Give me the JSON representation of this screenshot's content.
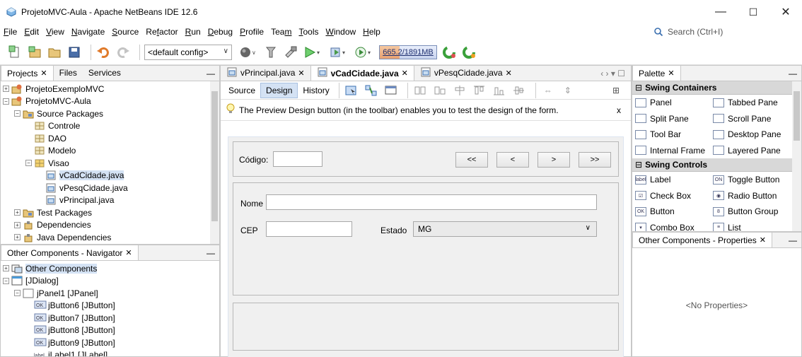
{
  "window": {
    "title": "ProjetoMVC-Aula - Apache NetBeans IDE 12.6",
    "minimize": "—",
    "maximize": "☐",
    "close": "✕"
  },
  "menu": {
    "items": [
      "File",
      "Edit",
      "View",
      "Navigate",
      "Source",
      "Refactor",
      "Run",
      "Debug",
      "Profile",
      "Team",
      "Tools",
      "Window",
      "Help"
    ],
    "search_placeholder": "Search (Ctrl+I)"
  },
  "toolbar": {
    "config": "<default config>",
    "memory": "665.2/1891MB",
    "memory_fraction": 0.35
  },
  "projects_panel": {
    "tabs": [
      "Projects",
      "Files",
      "Services"
    ],
    "tree": [
      {
        "label": "ProjetoExemploMVC",
        "level": 0,
        "exp": "+",
        "icon": "project"
      },
      {
        "label": "ProjetoMVC-Aula",
        "level": 0,
        "exp": "-",
        "icon": "project"
      },
      {
        "label": "Source Packages",
        "level": 1,
        "exp": "-",
        "icon": "folder"
      },
      {
        "label": "Controle",
        "level": 2,
        "exp": "",
        "icon": "package"
      },
      {
        "label": "DAO",
        "level": 2,
        "exp": "",
        "icon": "package"
      },
      {
        "label": "Modelo",
        "level": 2,
        "exp": "",
        "icon": "package"
      },
      {
        "label": "Visao",
        "level": 2,
        "exp": "-",
        "icon": "package-open"
      },
      {
        "label": "vCadCidade.java",
        "level": 3,
        "exp": "",
        "icon": "form",
        "selected": true
      },
      {
        "label": "vPesqCidade.java",
        "level": 3,
        "exp": "",
        "icon": "form"
      },
      {
        "label": "vPrincipal.java",
        "level": 3,
        "exp": "",
        "icon": "form"
      },
      {
        "label": "Test Packages",
        "level": 1,
        "exp": "+",
        "icon": "folder"
      },
      {
        "label": "Dependencies",
        "level": 1,
        "exp": "+",
        "icon": "jar"
      },
      {
        "label": "Java Dependencies",
        "level": 1,
        "exp": "+",
        "icon": "jar"
      }
    ]
  },
  "navigator_panel": {
    "title": "Other Components - Navigator",
    "tree": [
      {
        "label": "Other Components",
        "level": 0,
        "exp": "+",
        "icon": "components",
        "selected": true
      },
      {
        "label": "[JDialog]",
        "level": 0,
        "exp": "-",
        "icon": "dialog"
      },
      {
        "label": "jPanel1 [JPanel]",
        "level": 1,
        "exp": "-",
        "icon": "panel"
      },
      {
        "label": "jButton6 [JButton]",
        "level": 2,
        "exp": "",
        "icon": "ok"
      },
      {
        "label": "jButton7 [JButton]",
        "level": 2,
        "exp": "",
        "icon": "ok"
      },
      {
        "label": "jButton8 [JButton]",
        "level": 2,
        "exp": "",
        "icon": "ok"
      },
      {
        "label": "jButton9 [JButton]",
        "level": 2,
        "exp": "",
        "icon": "ok"
      },
      {
        "label": "jLabel1 [JLabel]",
        "level": 2,
        "exp": "",
        "icon": "label"
      }
    ]
  },
  "editor": {
    "tabs": [
      "vPrincipal.java",
      "vCadCidade.java",
      "vPesqCidade.java"
    ],
    "active_tab": 1,
    "sub_tabs": [
      "Source",
      "Design",
      "History"
    ],
    "active_sub_tab": 1,
    "info_message": "The Preview Design button (in the toolbar) enables you to test the design of the form.",
    "info_close": "x",
    "form": {
      "codigo_label": "Código:",
      "nav_buttons": [
        "<<",
        "<",
        ">",
        ">>"
      ],
      "nome_label": "Nome",
      "cep_label": "CEP",
      "estado_label": "Estado",
      "estado_value": "MG"
    }
  },
  "palette": {
    "title": "Palette",
    "sections": [
      {
        "header": "Swing Containers",
        "items": [
          "Panel",
          "Tabbed Pane",
          "Split Pane",
          "Scroll Pane",
          "Tool Bar",
          "Desktop Pane",
          "Internal Frame",
          "Layered Pane"
        ]
      },
      {
        "header": "Swing Controls",
        "items": [
          "Label",
          "Toggle Button",
          "Check Box",
          "Radio Button",
          "Button",
          "Button Group",
          "Combo Box",
          "List"
        ]
      }
    ]
  },
  "properties_panel": {
    "title": "Other Components - Properties",
    "empty": "<No Properties>"
  }
}
